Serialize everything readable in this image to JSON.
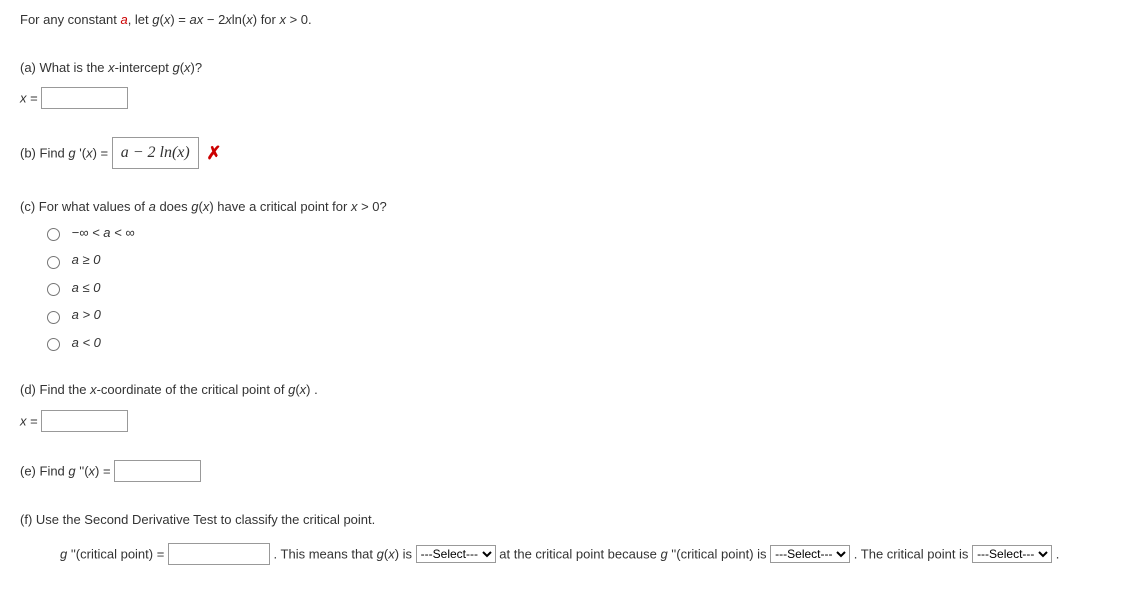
{
  "intro": {
    "pre": "For any constant ",
    "a": "a",
    "mid": ", let  ",
    "g": "g",
    "mid2": "(",
    "x": "x",
    "mid3": ") = ",
    "a2": "a",
    "x2": "x",
    "minus": " − ",
    "coef": "2",
    "x3": "x",
    "ln": "ln(",
    "x4": "x",
    "close": ")  for  ",
    "x5": "x",
    "gt": " > 0."
  },
  "partA": {
    "prompt_pre": "(a) What is the ",
    "xint": "x",
    "prompt_mid": "-intercept  ",
    "g": "g",
    "open": "(",
    "x": "x",
    "close": ")?",
    "label_x": "x",
    "equals": " = "
  },
  "partB": {
    "prompt": "(b) Find ",
    "g": "g ",
    "prime": "'(",
    "x": "x",
    "close": ") = ",
    "answer": "a − 2 ln(x)"
  },
  "partC": {
    "prompt_pre": "(c) For what values of ",
    "a": "a",
    "prompt_mid": " does  ",
    "g": "g",
    "open": "(",
    "x": "x",
    "close": ")  have a critical point for  ",
    "x2": "x",
    "gt": " > 0?",
    "options": [
      "−∞ < a < ∞",
      "a ≥ 0",
      "a ≤ 0",
      "a > 0",
      "a < 0"
    ]
  },
  "partD": {
    "prompt_pre": "(d) Find the ",
    "x": "x",
    "prompt_mid": "-coordinate of the critical point of  ",
    "g": "g",
    "open": "(",
    "x2": "x",
    "close": ") .",
    "label_x": "x",
    "equals": " = "
  },
  "partE": {
    "prompt": "(e) Find ",
    "g": "g ",
    "dprime": "''(",
    "x": "x",
    "close": ") = "
  },
  "partF": {
    "prompt": "(f) Use the Second Derivative Test to classify the critical point.",
    "g": "g ",
    "dprime": "''(critical point) = ",
    "t1": " . This means that ",
    "g2": "g",
    "open": "(",
    "x": "x",
    "close": ") is ",
    "t2": " at the critical point because ",
    "g3": "g ",
    "dprime2": "''(critical point) is ",
    "t3": " . The critical point is ",
    "t4": " .",
    "select_placeholder": "---Select---"
  }
}
